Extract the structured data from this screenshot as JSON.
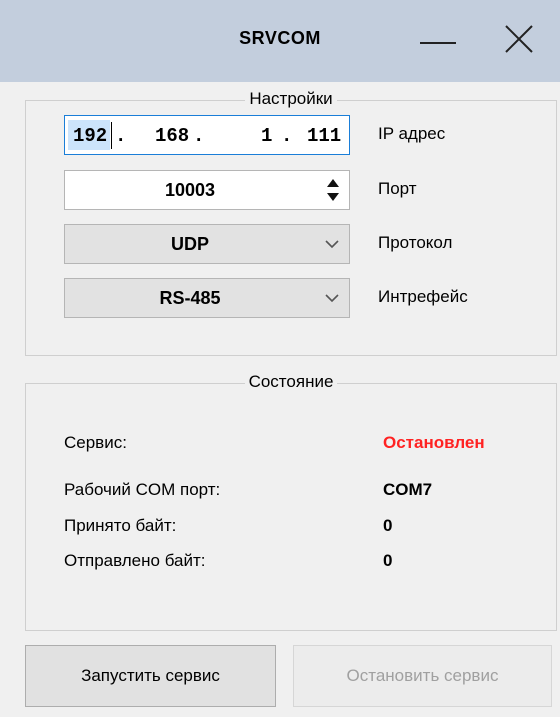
{
  "window": {
    "title": "SRVCOM"
  },
  "settings": {
    "group_title": "Настройки",
    "ip": {
      "octets": [
        "192",
        "168",
        "1",
        "111"
      ],
      "label": "IP адрес"
    },
    "port": {
      "value": "10003",
      "label": "Порт"
    },
    "protocol": {
      "value": "UDP",
      "label": "Протокол"
    },
    "interface": {
      "value": "RS-485",
      "label": "Интрефейс"
    }
  },
  "status": {
    "group_title": "Состояние",
    "rows": [
      {
        "label": "Сервис:",
        "value": "Остановлен",
        "color": "#ff2222"
      },
      {
        "label": "Рабочий COM порт:",
        "value": "COM7"
      },
      {
        "label": "Принято байт:",
        "value": "0"
      },
      {
        "label": "Отправлено байт:",
        "value": "0"
      }
    ]
  },
  "buttons": {
    "start_label": "Запустить сервис",
    "stop_label": "Остановить сервис"
  },
  "icons": {
    "minimize": "minimize-icon",
    "close": "close-icon",
    "spinner": "spinner-arrows-icon",
    "dropdown": "chevron-down-icon"
  }
}
